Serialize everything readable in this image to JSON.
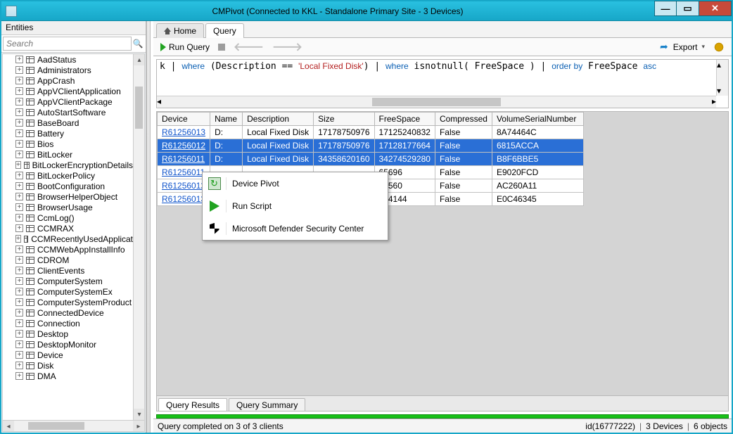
{
  "window": {
    "title": "CMPivot (Connected to KKL - Standalone Primary Site - 3 Devices)"
  },
  "entities": {
    "header": "Entities",
    "search_placeholder": "Search",
    "items": [
      "AadStatus",
      "Administrators",
      "AppCrash",
      "AppVClientApplication",
      "AppVClientPackage",
      "AutoStartSoftware",
      "BaseBoard",
      "Battery",
      "Bios",
      "BitLocker",
      "BitLockerEncryptionDetails",
      "BitLockerPolicy",
      "BootConfiguration",
      "BrowserHelperObject",
      "BrowserUsage",
      "CcmLog()",
      "CCMRAX",
      "CCMRecentlyUsedApplicat",
      "CCMWebAppInstallInfo",
      "CDROM",
      "ClientEvents",
      "ComputerSystem",
      "ComputerSystemEx",
      "ComputerSystemProduct",
      "ConnectedDevice",
      "Connection",
      "Desktop",
      "DesktopMonitor",
      "Device",
      "Disk",
      "DMA"
    ]
  },
  "tabs": {
    "home": "Home",
    "query": "Query"
  },
  "toolbar": {
    "run_query": "Run Query",
    "export": "Export"
  },
  "query_text_html": "k | <span class='kw'>where</span> (Description == <span class='str'>'Local Fixed Disk'</span>) | <span class='kw'>where</span> isnotnull( FreeSpace ) | <span class='kw'>order by</span> FreeSpace <span class='kw'>asc</span>",
  "results": {
    "columns": [
      "Device",
      "Name",
      "Description",
      "Size",
      "FreeSpace",
      "Compressed",
      "VolumeSerialNumber"
    ],
    "rows": [
      {
        "Device": "R61256013",
        "Name": "D:",
        "Description": "Local Fixed Disk",
        "Size": "17178750976",
        "FreeSpace": "17125240832",
        "Compressed": "False",
        "VolumeSerialNumber": "8A74464C",
        "selected": false
      },
      {
        "Device": "R61256012",
        "Name": "D:",
        "Description": "Local Fixed Disk",
        "Size": "17178750976",
        "FreeSpace": "17128177664",
        "Compressed": "False",
        "VolumeSerialNumber": "6815ACCA",
        "selected": true
      },
      {
        "Device": "R61256011",
        "Name": "D:",
        "Description": "Local Fixed Disk",
        "Size": "34358620160",
        "FreeSpace": "34274529280",
        "Compressed": "False",
        "VolumeSerialNumber": "B8F6BBE5",
        "selected": true
      },
      {
        "Device": "R61256011",
        "Name": "",
        "Description": "",
        "Size": "",
        "FreeSpace": "65696",
        "Compressed": "False",
        "VolumeSerialNumber": "E9020FCD",
        "selected": false
      },
      {
        "Device": "R61256012",
        "Name": "",
        "Description": "",
        "Size": "",
        "FreeSpace": "62560",
        "Compressed": "False",
        "VolumeSerialNumber": "AC260A11",
        "selected": false
      },
      {
        "Device": "R61256013",
        "Name": "",
        "Description": "",
        "Size": "",
        "FreeSpace": "694144",
        "Compressed": "False",
        "VolumeSerialNumber": "E0C46345",
        "selected": false
      }
    ],
    "tab_results": "Query Results",
    "tab_summary": "Query Summary"
  },
  "context_menu": {
    "device_pivot": "Device Pivot",
    "run_script": "Run Script",
    "defender": "Microsoft Defender Security Center"
  },
  "status": {
    "left": "Query completed on 3 of 3 clients",
    "id": "id(16777222)",
    "devices": "3 Devices",
    "objects": "6 objects"
  }
}
